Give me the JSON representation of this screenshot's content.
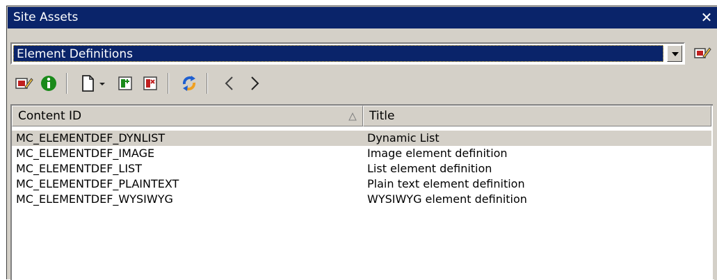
{
  "window": {
    "title": "Site Assets",
    "close_glyph": "✕"
  },
  "selector": {
    "value": "Element Definitions"
  },
  "toolbar": {
    "icons": [
      "properties-icon",
      "info-icon",
      "new-document-icon",
      "dropdown-arrow-icon",
      "check-in-icon",
      "check-out-icon",
      "refresh-icon",
      "back-icon",
      "forward-icon"
    ],
    "back_glyph": "<",
    "forward_glyph": ">"
  },
  "list": {
    "columns": [
      "Content ID",
      "Title"
    ],
    "sorted_column": "Content ID",
    "sort_direction": "ascending",
    "rows": [
      {
        "content_id": "MC_ELEMENTDEF_DYNLIST",
        "title": "Dynamic List",
        "selected": true
      },
      {
        "content_id": "MC_ELEMENTDEF_IMAGE",
        "title": "Image element definition",
        "selected": false
      },
      {
        "content_id": "MC_ELEMENTDEF_LIST",
        "title": "List element definition",
        "selected": false
      },
      {
        "content_id": "MC_ELEMENTDEF_PLAINTEXT",
        "title": "Plain text element definition",
        "selected": false
      },
      {
        "content_id": "MC_ELEMENTDEF_WYSIWYG",
        "title": "WYSIWYG element definition",
        "selected": false
      }
    ]
  },
  "colors": {
    "title_bar": "#0a246a",
    "panel_bg": "#d4d0c8",
    "selected_row": "#d4d0c8",
    "info_green": "#1a8a1a",
    "refresh_blue": "#1f5fd0",
    "refresh_orange": "#f0a020",
    "doc_red": "#c02020"
  }
}
